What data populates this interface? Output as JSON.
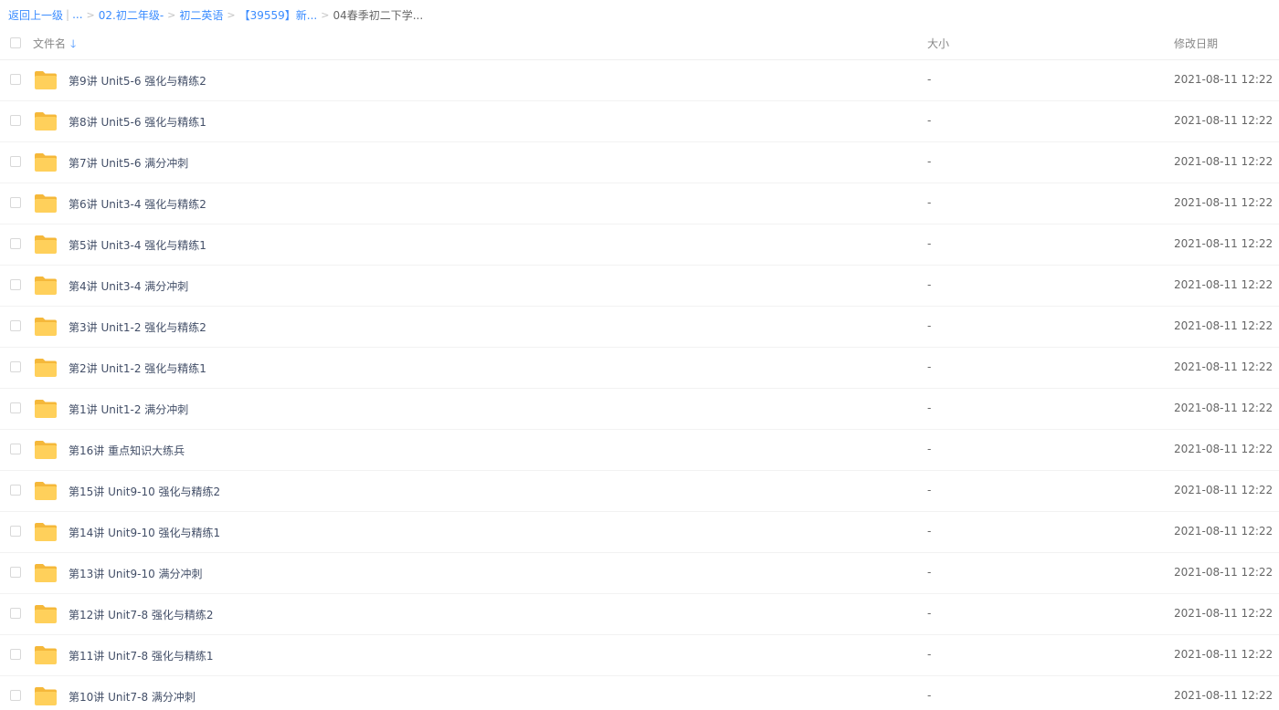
{
  "breadcrumb": {
    "back": "返回上一级",
    "pipe": "|",
    "ellipsis": "...",
    "sep": ">",
    "items": [
      "02.初二年级-",
      "初二英语",
      "【39559】新...",
      "04春季初二下学..."
    ]
  },
  "header": {
    "name": "文件名",
    "sort_icon": "arrow-down-icon",
    "size": "大小",
    "date": "修改日期"
  },
  "colors": {
    "link": "#3b8cff",
    "folder": "#ffd05b"
  },
  "files": [
    {
      "name": "第9讲 Unit5-6 强化与精练2",
      "size": "-",
      "date": "2021-08-11 12:22",
      "icon": "folder-icon"
    },
    {
      "name": "第8讲 Unit5-6 强化与精练1",
      "size": "-",
      "date": "2021-08-11 12:22",
      "icon": "folder-icon"
    },
    {
      "name": "第7讲 Unit5-6 满分冲刺",
      "size": "-",
      "date": "2021-08-11 12:22",
      "icon": "folder-icon"
    },
    {
      "name": "第6讲 Unit3-4 强化与精练2",
      "size": "-",
      "date": "2021-08-11 12:22",
      "icon": "folder-icon"
    },
    {
      "name": "第5讲 Unit3-4 强化与精练1",
      "size": "-",
      "date": "2021-08-11 12:22",
      "icon": "folder-icon"
    },
    {
      "name": "第4讲 Unit3-4 满分冲刺",
      "size": "-",
      "date": "2021-08-11 12:22",
      "icon": "folder-icon"
    },
    {
      "name": "第3讲 Unit1-2 强化与精练2",
      "size": "-",
      "date": "2021-08-11 12:22",
      "icon": "folder-icon"
    },
    {
      "name": "第2讲 Unit1-2 强化与精练1",
      "size": "-",
      "date": "2021-08-11 12:22",
      "icon": "folder-icon"
    },
    {
      "name": "第1讲 Unit1-2 满分冲刺",
      "size": "-",
      "date": "2021-08-11 12:22",
      "icon": "folder-icon"
    },
    {
      "name": "第16讲 重点知识大练兵",
      "size": "-",
      "date": "2021-08-11 12:22",
      "icon": "folder-icon"
    },
    {
      "name": "第15讲 Unit9-10 强化与精练2",
      "size": "-",
      "date": "2021-08-11 12:22",
      "icon": "folder-icon"
    },
    {
      "name": "第14讲 Unit9-10 强化与精练1",
      "size": "-",
      "date": "2021-08-11 12:22",
      "icon": "folder-icon"
    },
    {
      "name": "第13讲 Unit9-10 满分冲刺",
      "size": "-",
      "date": "2021-08-11 12:22",
      "icon": "folder-icon"
    },
    {
      "name": "第12讲 Unit7-8 强化与精练2",
      "size": "-",
      "date": "2021-08-11 12:22",
      "icon": "folder-icon"
    },
    {
      "name": "第11讲 Unit7-8 强化与精练1",
      "size": "-",
      "date": "2021-08-11 12:22",
      "icon": "folder-icon"
    },
    {
      "name": "第10讲 Unit7-8 满分冲刺",
      "size": "-",
      "date": "2021-08-11 12:22",
      "icon": "folder-icon"
    }
  ]
}
